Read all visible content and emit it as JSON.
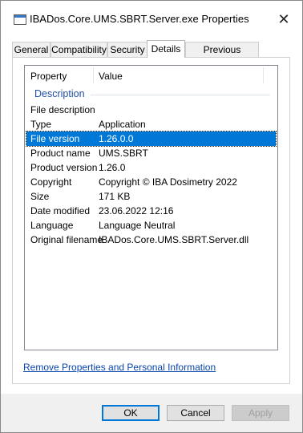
{
  "window": {
    "title": "IBADos.Core.UMS.SBRT.Server.exe Properties",
    "close_glyph": "✕"
  },
  "tabs": [
    {
      "label": "General"
    },
    {
      "label": "Compatibility"
    },
    {
      "label": "Security"
    },
    {
      "label": "Details",
      "active": true
    },
    {
      "label": "Previous Versions"
    }
  ],
  "list": {
    "columns": {
      "property": "Property",
      "value": "Value"
    },
    "group": "Description",
    "rows": [
      {
        "property": "File description",
        "value": ""
      },
      {
        "property": "Type",
        "value": "Application"
      },
      {
        "property": "File version",
        "value": "1.26.0.0",
        "selected": true
      },
      {
        "property": "Product name",
        "value": "UMS.SBRT"
      },
      {
        "property": "Product version",
        "value": "1.26.0"
      },
      {
        "property": "Copyright",
        "value": "Copyright © IBA Dosimetry 2022"
      },
      {
        "property": "Size",
        "value": "171 KB"
      },
      {
        "property": "Date modified",
        "value": "23.06.2022 12:16"
      },
      {
        "property": "Language",
        "value": "Language Neutral"
      },
      {
        "property": "Original filename",
        "value": "IBADos.Core.UMS.SBRT.Server.dll"
      }
    ]
  },
  "remove_link": "Remove Properties and Personal Information",
  "buttons": {
    "ok": "OK",
    "cancel": "Cancel",
    "apply": "Apply"
  },
  "colors": {
    "selection": "#0078d7",
    "link": "#0645ad",
    "group_label": "#1f4ea0"
  }
}
